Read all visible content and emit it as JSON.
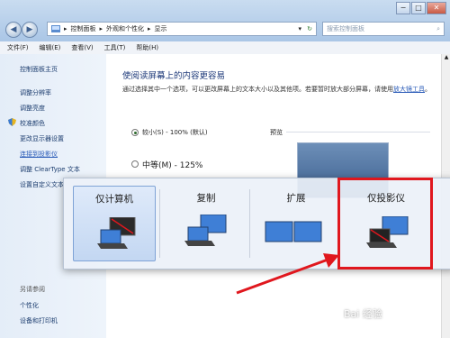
{
  "window": {
    "controls": {
      "minimize": "−",
      "maximize": "□",
      "close": "✕"
    }
  },
  "address_bar": {
    "segments": [
      "控制面板",
      "外观和个性化",
      "显示"
    ],
    "separator": "▸",
    "dropdown": "▾",
    "refresh": "↻"
  },
  "search": {
    "placeholder": "搜索控制面板"
  },
  "menu": {
    "file": "文件(F)",
    "edit": "编辑(E)",
    "view": "查看(V)",
    "tools": "工具(T)",
    "help": "帮助(H)"
  },
  "sidebar": {
    "home": "控制面板主页",
    "resolution": "调整分辨率",
    "brightness": "调整亮度",
    "calibrate": "校准颜色",
    "display_settings": "更改显示器设置",
    "projector": "连接到投影仪",
    "cleartype": "调整 ClearType 文本",
    "custom_text": "设置自定义文本",
    "see_also": "另请参阅",
    "personalization": "个性化",
    "devices": "设备和打印机"
  },
  "main": {
    "heading": "使阅读屏幕上的内容更容易",
    "description": "通过选择其中一个选项，可以更改屏幕上的文本大小以及其他项。若要暂时放大部分屏幕，请使用",
    "magnifier_link": "放大镜工具",
    "description_end": "。",
    "preview_label": "预览",
    "options": [
      {
        "label": "较小(S) - 100% (默认)",
        "selected": true
      },
      {
        "label": "中等(M) - 125%",
        "selected": false
      }
    ]
  },
  "projection_switcher": {
    "options": [
      {
        "label": "仅计算机",
        "selected": true,
        "icon": "computer-only-icon"
      },
      {
        "label": "复制",
        "selected": false,
        "icon": "duplicate-icon"
      },
      {
        "label": "扩展",
        "selected": false,
        "icon": "extend-icon"
      },
      {
        "label": "仅投影仪",
        "selected": false,
        "icon": "projector-only-icon"
      }
    ]
  },
  "annotation": {
    "color": "#e0171e"
  },
  "watermark": {
    "text": "Bai 经验"
  },
  "colors": {
    "titlebar": "#aac6e6",
    "sidebar_bg": "#e4edf8",
    "link": "#2b5cb8",
    "heading": "#1e3a7a",
    "highlight": "#e0171e"
  }
}
